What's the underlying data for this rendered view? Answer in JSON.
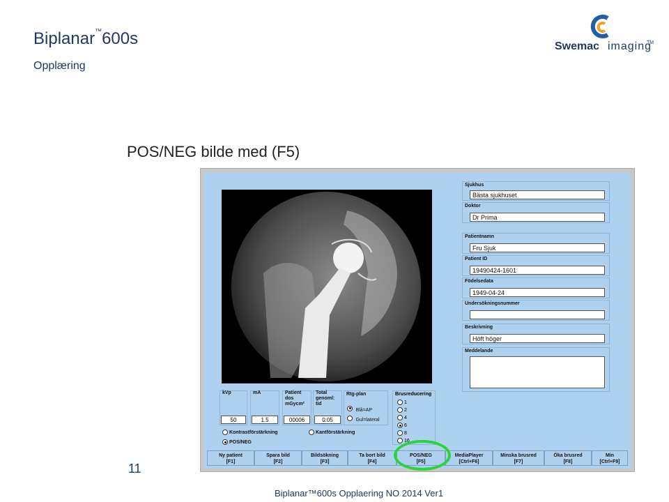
{
  "header": {
    "brand": "Biplanar",
    "brand_tm": "™",
    "brand_model": "600s",
    "subtitle": "Opplæring"
  },
  "logo": {
    "word_bold": "Swemac",
    "word_light": "imaging",
    "tm": "TM"
  },
  "slide_title": "POS/NEG bilde med (F5)",
  "page_number": "11",
  "footer_text": "Biplanar™600s Opplaering NO 2014 Ver1",
  "patient_panel": {
    "sjukhus_label": "Sjukhus",
    "sjukhus_value": "Bästa sjukhuset",
    "doktor_label": "Doktor",
    "doktor_value": "Dr Prima",
    "patientnamn_label": "Patientnamn",
    "patientnamn_value": "Fru Sjuk",
    "patient_id_label": "Patient ID",
    "patient_id_value": "19490424-1601",
    "fodelsedata_label": "Födelsedata",
    "fodelsedata_value": "1949-04-24",
    "undersokningsnummer_label": "Undersökningsnummer",
    "undersokningsnummer_value": "",
    "beskrivning_label": "Beskrivning",
    "beskrivning_value": "Höft höger",
    "meddelande_label": "Meddelande",
    "meddelande_value": ""
  },
  "params": {
    "kvp_label": "kVp",
    "kvp_value": "50",
    "ma_label": "mA",
    "ma_value": "1.5",
    "dos_label": "Patient dos mGycm²",
    "dos_value": "00006",
    "tid_label": "Total genoml: tid",
    "tid_value": "0:05"
  },
  "rtg_plan": {
    "title": "Rtg-plan",
    "opt1": "Blå=AP",
    "opt2": "Gul=lateral",
    "selected": "Blå=AP"
  },
  "brusreducering": {
    "title": "Brusreducering",
    "levels": [
      "1",
      "2",
      "4",
      "6",
      "8",
      "16"
    ],
    "selected": "6"
  },
  "options": {
    "kontrast": "Kontrastförstärkning",
    "kant": "Kantförstärkning",
    "posneg": "POS/NEG"
  },
  "buttons": [
    {
      "label": "Ny patient",
      "key": "[F1]"
    },
    {
      "label": "Spara bild",
      "key": "[F2]"
    },
    {
      "label": "Bildsökning",
      "key": "[F3]"
    },
    {
      "label": "Ta bort bild",
      "key": "[F4]"
    },
    {
      "label": "POS/NEG",
      "key": "[F5]"
    },
    {
      "label": "MediaPlayer",
      "key": "[Ctrl+F6]"
    },
    {
      "label": "Minska brusred",
      "key": "[F7]"
    },
    {
      "label": "Öka brusred",
      "key": "[F8]"
    },
    {
      "label": "Min",
      "key": "[Ctrl+F9]"
    }
  ],
  "colors": {
    "panel": "#aed1ef",
    "highlight_ring": "#2bd43a",
    "title": "#1f3864"
  }
}
